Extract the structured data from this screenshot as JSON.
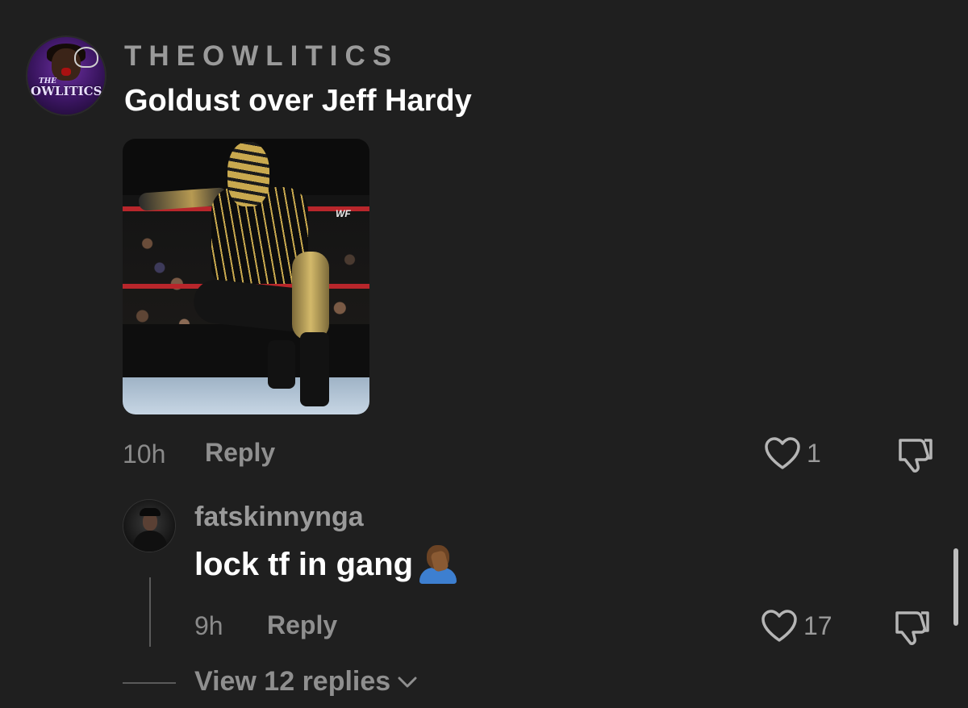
{
  "comment": {
    "username": "THEOWLITICS",
    "avatar_logo_small": "THE",
    "avatar_logo_text": "OWLITICS",
    "text": "Goldust over Jeff Hardy",
    "image_watermark": "WF",
    "time": "10h",
    "reply_label": "Reply",
    "likes": "1"
  },
  "reply": {
    "username": "fatskinnynga",
    "text": "lock tf in gang",
    "emoji": "facepalm-emoji",
    "time": "9h",
    "reply_label": "Reply",
    "likes": "17"
  },
  "view_replies_label": "View 12 replies",
  "icons": {
    "like": "heart-icon",
    "dislike": "thumbs-down-icon",
    "expand": "chevron-down-icon"
  },
  "colors": {
    "background": "#1f1f1f",
    "secondary_text": "#8f8f8f",
    "primary_text": "#ffffff"
  }
}
